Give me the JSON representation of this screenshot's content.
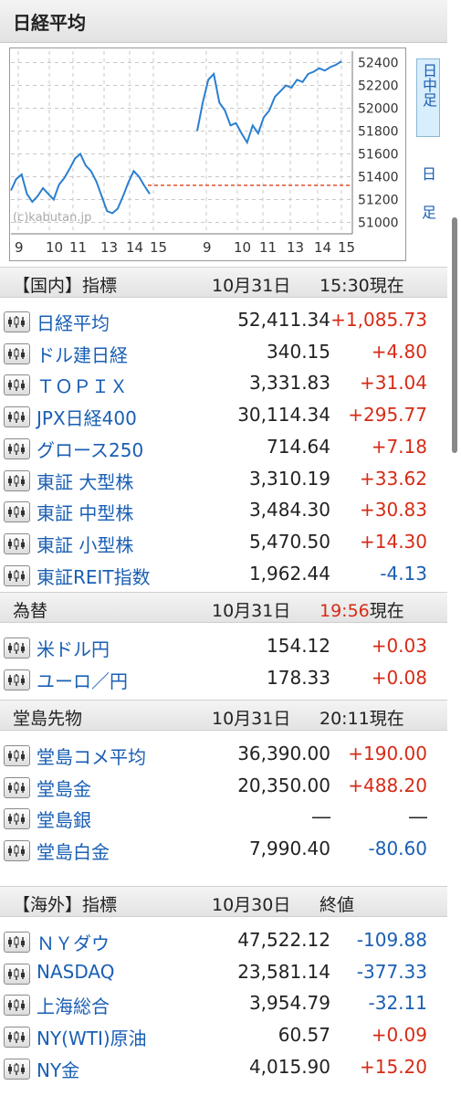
{
  "header": {
    "title": "日経平均"
  },
  "chart_data": {
    "type": "line",
    "watermark": "(c)kabutan.jp",
    "y_ticks": [
      "52400",
      "52200",
      "52000",
      "51800",
      "51600",
      "51400",
      "51200",
      "51000"
    ],
    "ylim": [
      50900,
      52500
    ],
    "x_ticks_left": [
      "9",
      "10",
      "11",
      "13",
      "14",
      "15"
    ],
    "x_ticks_right": [
      "9",
      "10",
      "11",
      "13",
      "14",
      "15"
    ],
    "previous_close": 51325,
    "series": [
      {
        "values": [
          51280,
          51380,
          51420,
          51250,
          51180,
          51230,
          51300,
          51250,
          51200,
          51330,
          51390,
          51470,
          51560,
          51600,
          51500,
          51450,
          51360,
          51230,
          51100,
          51080,
          51120,
          51230,
          51350,
          51450,
          51400,
          51320,
          51250
        ]
      },
      {
        "values": [
          51800,
          52050,
          52250,
          52300,
          52050,
          51980,
          51850,
          51870,
          51780,
          51700,
          51850,
          51780,
          51920,
          51980,
          52100,
          52150,
          52200,
          52180,
          52250,
          52230,
          52300,
          52320,
          52350,
          52330,
          52360,
          52380,
          52411
        ]
      }
    ],
    "side_tabs": [
      {
        "label": "日中足",
        "active": true
      },
      {
        "label": "日足",
        "active": false
      }
    ]
  },
  "domestic": {
    "header": {
      "name": "【国内】指標",
      "date": "10月31日",
      "time": "15:30現在"
    },
    "rows": [
      {
        "name": "日経平均",
        "price": "52,411.34",
        "change": "+1,085.73",
        "dir": "up"
      },
      {
        "name": "ドル建日経",
        "price": "340.15",
        "change": "+4.80",
        "dir": "up"
      },
      {
        "name": "ＴＯＰＩＸ",
        "price": "3,331.83",
        "change": "+31.04",
        "dir": "up"
      },
      {
        "name": "JPX日経400",
        "price": "30,114.34",
        "change": "+295.77",
        "dir": "up"
      },
      {
        "name": "グロース250",
        "price": "714.64",
        "change": "+7.18",
        "dir": "up"
      },
      {
        "name": "東証 大型株",
        "price": "3,310.19",
        "change": "+33.62",
        "dir": "up"
      },
      {
        "name": "東証 中型株",
        "price": "3,484.30",
        "change": "+30.83",
        "dir": "up"
      },
      {
        "name": "東証 小型株",
        "price": "5,470.50",
        "change": "+14.30",
        "dir": "up"
      },
      {
        "name": "東証REIT指数",
        "price": "1,962.44",
        "change": "-4.13",
        "dir": "down"
      }
    ]
  },
  "fx": {
    "header": {
      "name": "為替",
      "date": "10月31日",
      "time_red": "19:56",
      "time_suffix": "現在"
    },
    "rows": [
      {
        "name": "米ドル円",
        "price": "154.12",
        "change": "+0.03",
        "dir": "up"
      },
      {
        "name": "ユーロ／円",
        "price": "178.33",
        "change": "+0.08",
        "dir": "up"
      }
    ]
  },
  "dojima": {
    "header": {
      "name": "堂島先物",
      "date": "10月31日",
      "time": "20:11現在"
    },
    "rows": [
      {
        "name": "堂島コメ平均",
        "price": "36,390.00",
        "change": "+190.00",
        "dir": "up"
      },
      {
        "name": "堂島金",
        "price": "20,350.00",
        "change": "+488.20",
        "dir": "up"
      },
      {
        "name": "堂島銀",
        "price": "―",
        "change": "―",
        "dir": "flat"
      },
      {
        "name": "堂島白金",
        "price": "7,990.40",
        "change": "-80.60",
        "dir": "down"
      }
    ]
  },
  "overseas": {
    "header": {
      "name": "【海外】指標",
      "date": "10月30日",
      "time": "終値"
    },
    "rows": [
      {
        "name": "ＮＹダウ",
        "price": "47,522.12",
        "change": "-109.88",
        "dir": "down"
      },
      {
        "name": "NASDAQ",
        "price": "23,581.14",
        "change": "-377.33",
        "dir": "down"
      },
      {
        "name": "上海総合",
        "price": "3,954.79",
        "change": "-32.11",
        "dir": "down"
      },
      {
        "name": "NY(WTI)原油",
        "price": "60.57",
        "change": "+0.09",
        "dir": "up"
      },
      {
        "name": "NY金",
        "price": "4,015.90",
        "change": "+15.20",
        "dir": "up"
      }
    ]
  }
}
